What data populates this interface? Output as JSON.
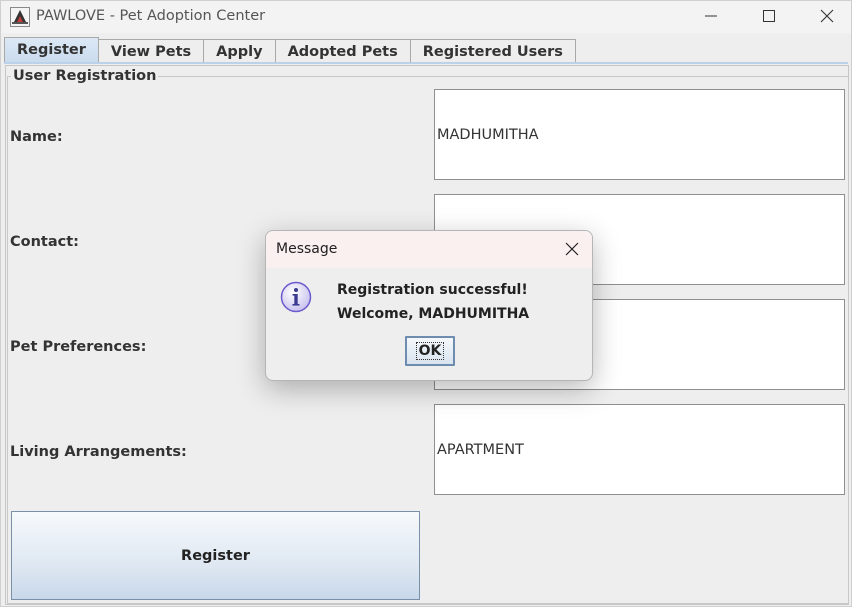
{
  "window": {
    "title": "PAWLOVE - Pet Adoption Center"
  },
  "tabs": [
    {
      "label": "Register",
      "active": true
    },
    {
      "label": "View Pets"
    },
    {
      "label": "Apply"
    },
    {
      "label": "Adopted Pets"
    },
    {
      "label": "Registered Users"
    }
  ],
  "form": {
    "group_title": "User Registration",
    "fields": [
      {
        "label": "Name:",
        "value": "MADHUMITHA"
      },
      {
        "label": "Contact:",
        "value": ""
      },
      {
        "label": "Pet Preferences:",
        "value": ""
      },
      {
        "label": "Living Arrangements:",
        "value": "APARTMENT"
      }
    ],
    "submit_label": "Register"
  },
  "dialog": {
    "title": "Message",
    "line1": "Registration successful!",
    "line2": "Welcome, MADHUMITHA",
    "ok_label": "OK",
    "icon": "info-icon"
  },
  "colors": {
    "tab_active": "#c9dbee",
    "button_border": "#6d8cb0",
    "info_icon": "#6a5acd"
  }
}
